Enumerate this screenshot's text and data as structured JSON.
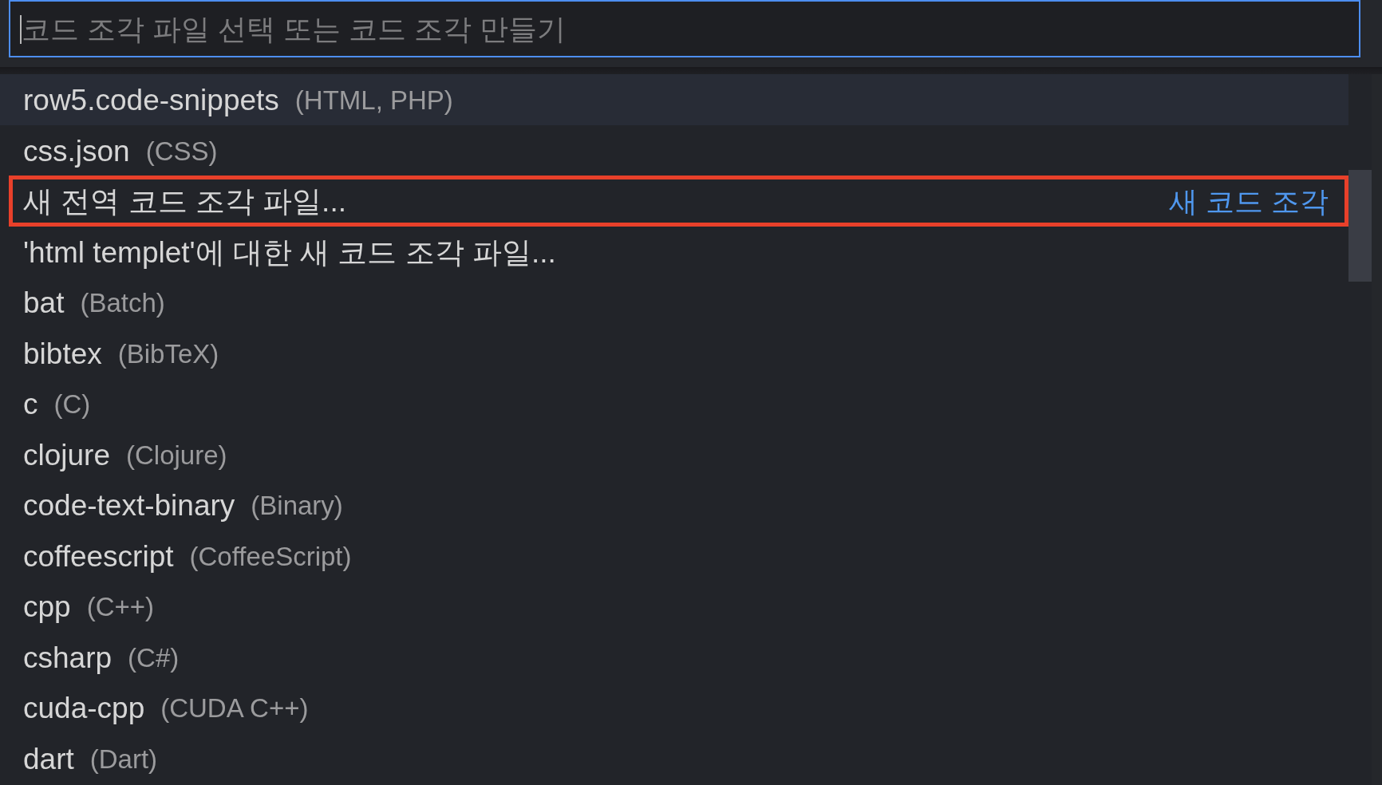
{
  "search": {
    "placeholder": "코드 조각 파일 선택 또는 코드 조각 만들기"
  },
  "items": [
    {
      "label": "row5.code-snippets",
      "description": "(HTML, PHP)",
      "selected": true,
      "highlighted": false
    },
    {
      "label": "css.json",
      "description": "(CSS)",
      "selected": false,
      "highlighted": false
    },
    {
      "label": "새 전역 코드 조각 파일...",
      "group_label": "새 코드 조각",
      "selected": false,
      "highlighted": true
    },
    {
      "label": "'html templet'에 대한 새 코드 조각 파일...",
      "selected": false,
      "highlighted": false
    },
    {
      "label": "bat",
      "description": "(Batch)",
      "selected": false,
      "highlighted": false
    },
    {
      "label": "bibtex",
      "description": "(BibTeX)",
      "selected": false,
      "highlighted": false
    },
    {
      "label": "c",
      "description": "(C)",
      "selected": false,
      "highlighted": false
    },
    {
      "label": "clojure",
      "description": "(Clojure)",
      "selected": false,
      "highlighted": false
    },
    {
      "label": "code-text-binary",
      "description": "(Binary)",
      "selected": false,
      "highlighted": false
    },
    {
      "label": "coffeescript",
      "description": "(CoffeeScript)",
      "selected": false,
      "highlighted": false
    },
    {
      "label": "cpp",
      "description": "(C++)",
      "selected": false,
      "highlighted": false
    },
    {
      "label": "csharp",
      "description": "(C#)",
      "selected": false,
      "highlighted": false
    },
    {
      "label": "cuda-cpp",
      "description": "(CUDA C++)",
      "selected": false,
      "highlighted": false
    },
    {
      "label": "dart",
      "description": "(Dart)",
      "selected": false,
      "highlighted": false
    }
  ]
}
